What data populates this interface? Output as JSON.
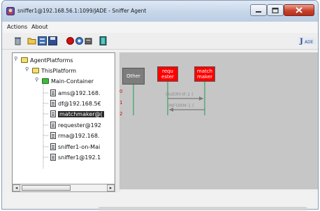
{
  "window": {
    "title": "sniffer1@192.168.56.1:1099/JADE - Sniffer Agent",
    "accent": "#c6d6ea"
  },
  "menu": {
    "items": [
      "Actions",
      "About"
    ]
  },
  "toolbar": {
    "icons": [
      "trash-icon",
      "open-folder-icon",
      "swap-icon",
      "save-icon",
      "record-icon",
      "filter-icon",
      "bin-icon",
      "exit-door-icon",
      "jade-logo-icon"
    ]
  },
  "tree": {
    "root": "AgentPlatforms",
    "platform": "ThisPlatform",
    "container": "Main-Container",
    "agents": [
      "ams@192.168.",
      "df@192.168.5€",
      "matchmaker@(",
      "requester@192",
      "rma@192.168.",
      "sniffer1-on-Mai",
      "sniffer1@192.1"
    ],
    "selected_index": 2
  },
  "sniffer": {
    "agents": [
      "Other",
      "requ\nester",
      "match\nmaker"
    ],
    "row_numbers": [
      "0",
      "1",
      "2"
    ],
    "messages": [
      "QUERY-IF:1 (",
      "INFORM:1 ("
    ],
    "colors": {
      "sniffed_agent": "#ff0000",
      "other_agent": "#7d7d7d",
      "canvas": "#c6c6c6"
    }
  }
}
